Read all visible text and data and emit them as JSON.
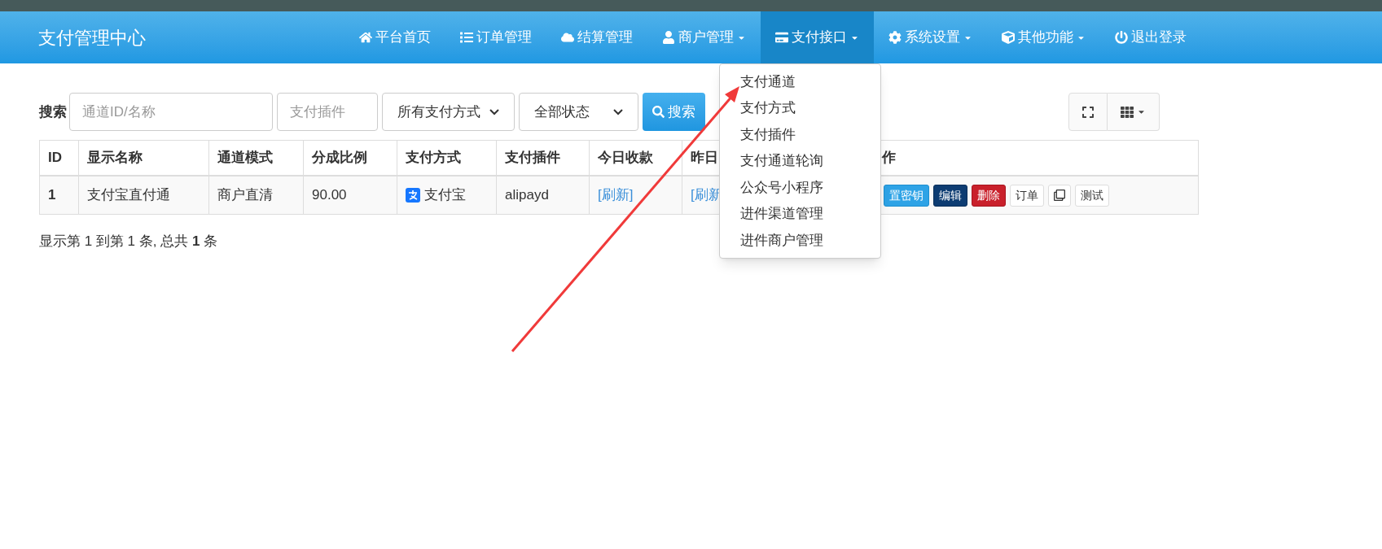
{
  "navbar": {
    "brand": "支付管理中心",
    "items": [
      {
        "label": "平台首页",
        "caret": false,
        "selected": false
      },
      {
        "label": "订单管理",
        "caret": false,
        "selected": false
      },
      {
        "label": "结算管理",
        "caret": false,
        "selected": false
      },
      {
        "label": "商户管理",
        "caret": true,
        "selected": false
      },
      {
        "label": "支付接口",
        "caret": true,
        "selected": true
      },
      {
        "label": "系统设置",
        "caret": true,
        "selected": false
      },
      {
        "label": "其他功能",
        "caret": true,
        "selected": false
      },
      {
        "label": "退出登录",
        "caret": false,
        "selected": false
      }
    ]
  },
  "dropdown": [
    "支付通道",
    "支付方式",
    "支付插件",
    "支付通道轮询",
    "公众号小程序",
    "进件渠道管理",
    "进件商户管理"
  ],
  "search": {
    "label": "搜索",
    "fields": [
      {
        "kind": "input",
        "placeholder": "通道ID/名称"
      },
      {
        "kind": "input",
        "placeholder": "支付插件"
      },
      {
        "kind": "select",
        "value": "所有支付方式"
      },
      {
        "kind": "select",
        "value": "全部状态"
      }
    ],
    "button": "搜索"
  },
  "table": {
    "columns": [
      "ID",
      "显示名称",
      "通道模式",
      "分成比例",
      "支付方式",
      "支付插件",
      "今日收款",
      "昨日",
      "作"
    ],
    "rows": [
      {
        "cells": [
          "1",
          "支付宝直付通",
          "商户直清",
          "90.00",
          "支付宝",
          "alipayd",
          "[刷新]",
          "[刷新"
        ],
        "actions": [
          {
            "kind": "primary",
            "label": "置密钥"
          },
          {
            "kind": "dark",
            "label": "编辑"
          },
          {
            "kind": "danger",
            "label": "删除"
          },
          {
            "kind": "default",
            "label": "订单"
          },
          {
            "kind": "copy"
          },
          {
            "kind": "default",
            "label": "测试"
          }
        ]
      }
    ]
  },
  "footer": "显示第 1 到第 1 条, 总共 **1** 条"
}
